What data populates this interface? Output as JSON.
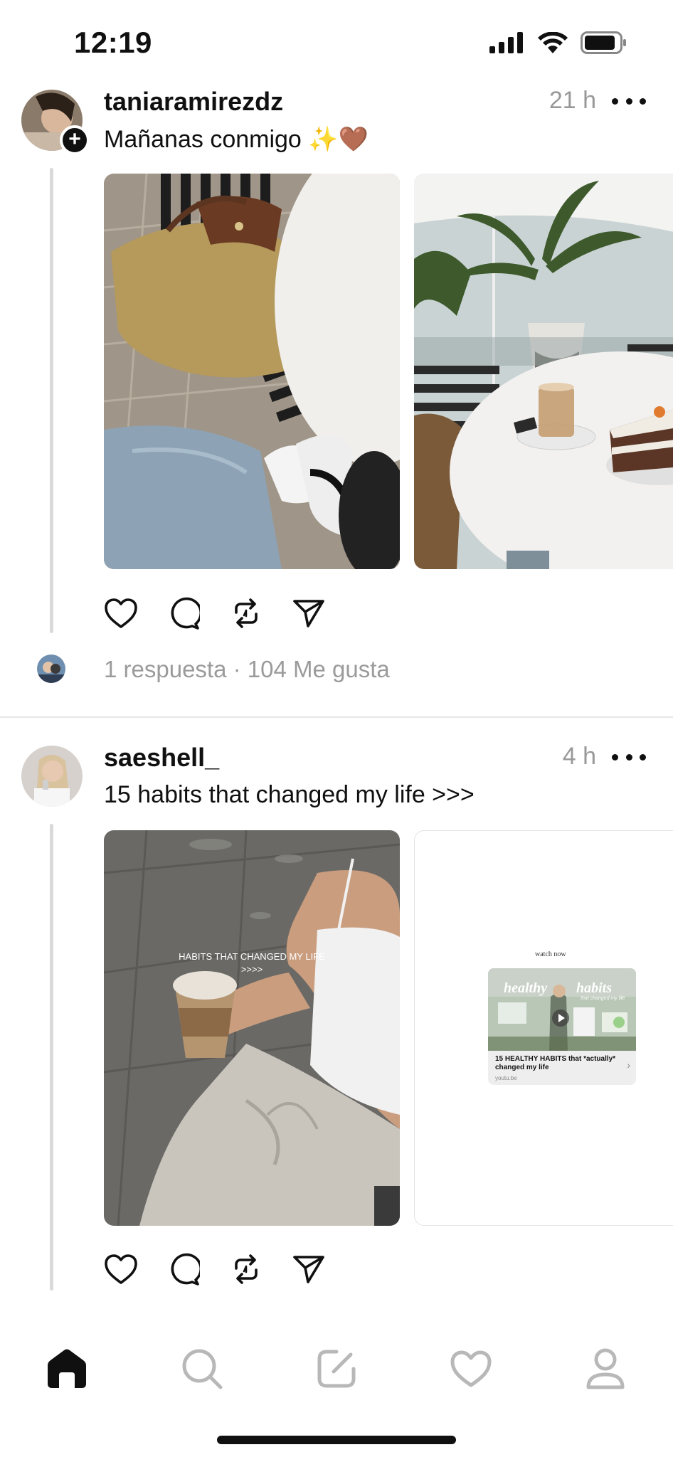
{
  "status": {
    "time": "12:19"
  },
  "posts": [
    {
      "username": "taniaramirezdz",
      "time": "21 h",
      "caption": "Mañanas conmigo",
      "caption_emoji": "✨🤎",
      "meta": "1 respuesta · 104 Me gusta"
    },
    {
      "username": "saeshell_",
      "time": "4 h",
      "caption": "15 habits that changed my life >>>",
      "image_overlay_line1": "HABITS THAT CHANGED MY LIFE",
      "image_overlay_line2": ">>>>",
      "link_card": {
        "watch_label": "watch now",
        "thumb_word1": "healthy",
        "thumb_word2": "habits",
        "thumb_sub": "that changed my life",
        "title": "15 HEALTHY HABITS that *actually* changed my life",
        "domain": "youtu.be"
      }
    }
  ],
  "tabs": [
    "home-icon",
    "search-icon",
    "compose-icon",
    "heart-icon",
    "profile-icon"
  ],
  "colors": {
    "text": "#101010",
    "muted": "#999999",
    "line": "#d9d9d9"
  }
}
